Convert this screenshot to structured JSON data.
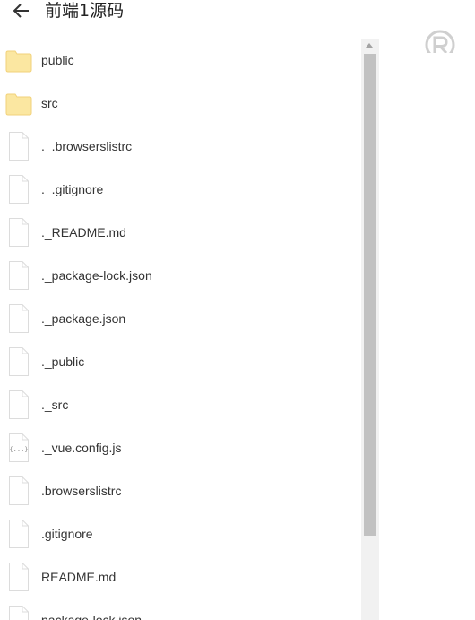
{
  "header": {
    "title": "前端1源码",
    "back_icon": "arrow-left-icon"
  },
  "files": [
    {
      "name": "public",
      "icon": "folder-icon"
    },
    {
      "name": "src",
      "icon": "folder-icon"
    },
    {
      "name": "._.browserslistrc",
      "icon": "file-icon"
    },
    {
      "name": "._.gitignore",
      "icon": "file-icon"
    },
    {
      "name": "._README.md",
      "icon": "file-icon"
    },
    {
      "name": "._package-lock.json",
      "icon": "file-icon"
    },
    {
      "name": "._package.json",
      "icon": "file-icon"
    },
    {
      "name": "._public",
      "icon": "file-icon"
    },
    {
      "name": "._src",
      "icon": "file-icon"
    },
    {
      "name": "._vue.config.js",
      "icon": "code-file-icon"
    },
    {
      "name": ".browserslistrc",
      "icon": "file-icon"
    },
    {
      "name": ".gitignore",
      "icon": "file-icon"
    },
    {
      "name": "README.md",
      "icon": "file-icon"
    },
    {
      "name": "package-lock.json",
      "icon": "file-icon"
    }
  ],
  "scrollbar": {
    "position_fraction": 0.0,
    "visible_fraction": 0.84
  },
  "colors": {
    "folder": "#fbe7a1",
    "folder_edge": "#f2d27a",
    "file_border": "#dcdcdc",
    "text": "#333333",
    "scroll_track": "#f1f1f1",
    "scroll_thumb": "#c1c1c1",
    "logo": "#cfcfcf"
  }
}
